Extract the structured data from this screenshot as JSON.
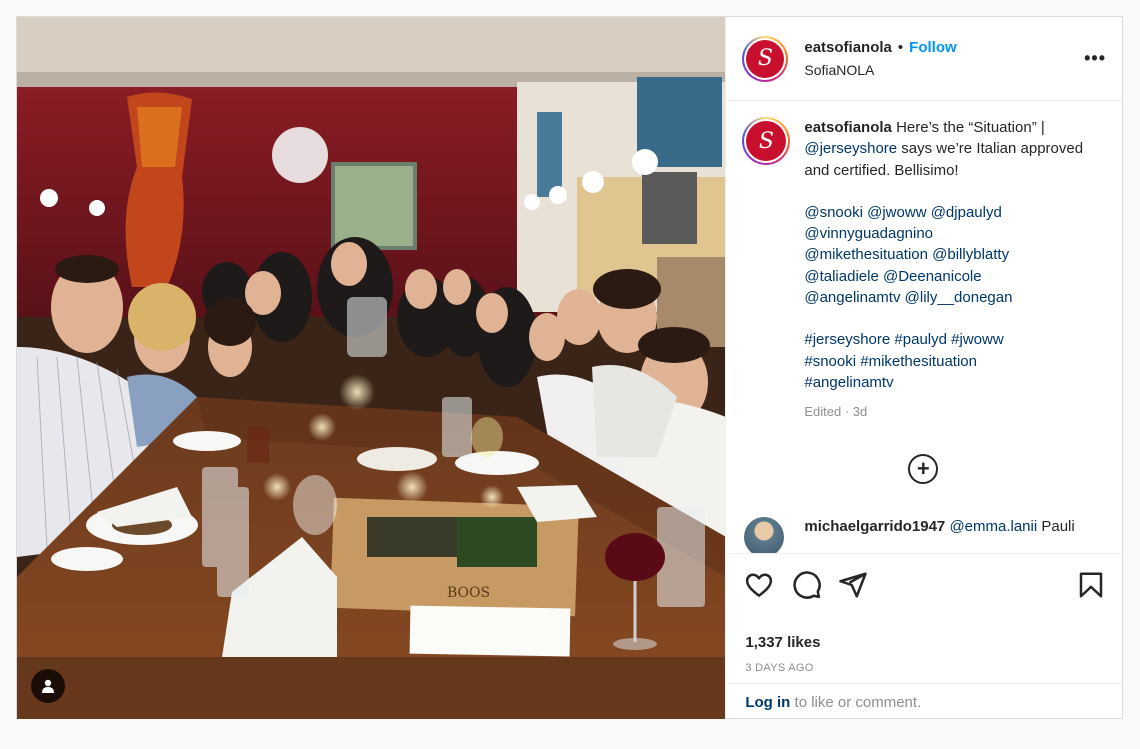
{
  "post": {
    "username": "eatsofianola",
    "separator": "•",
    "follow_label": "Follow",
    "location": "SofiaNOLA",
    "more_label": "•••",
    "avatar_letter": "S"
  },
  "caption": {
    "username": "eatsofianola",
    "line1": "Here’s the “Situation” |",
    "mention_jerseyshore": "@jerseyshore",
    "line1b": " says we’re Italian approved and certified. Bellisimo!",
    "mentions": [
      "@snooki",
      "@jwoww",
      "@djpaulyd",
      "@vinnyguadagnino",
      "@mikethesituation",
      "@billyblatty",
      "@taliadiele",
      "@Deenanicole",
      "@angelinamtv",
      "@lily__donegan"
    ],
    "hashtags": [
      "#jerseyshore",
      "#paulyd",
      "#jwoww",
      "#snooki",
      "#mikethesituation",
      "#angelinamtv"
    ],
    "edited": "Edited · 3d"
  },
  "comment": {
    "username": "michaelgarrido1947",
    "mention": "@emma.lanii",
    "text": " Pauli"
  },
  "engagement": {
    "likes": "1,337 likes",
    "time": "3 DAYS AGO"
  },
  "login": {
    "link": "Log in",
    "text": " to like or comment."
  },
  "photo": {
    "board_text": "BOOS"
  },
  "colors": {
    "accent": "#0095f6",
    "brand": "#c8102e",
    "link": "#00376b"
  }
}
